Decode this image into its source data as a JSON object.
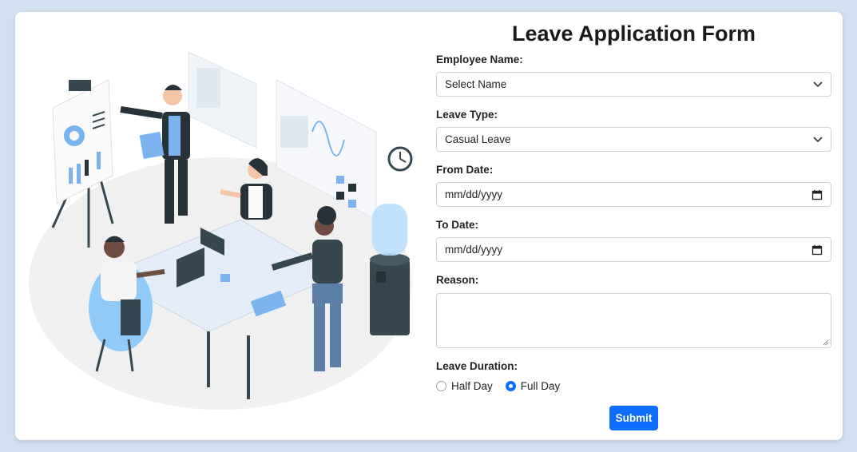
{
  "form": {
    "title": "Leave Application Form",
    "employee_name": {
      "label": "Employee Name:",
      "value": "Select Name"
    },
    "leave_type": {
      "label": "Leave Type:",
      "value": "Casual Leave"
    },
    "from_date": {
      "label": "From Date:",
      "value": "mm/dd/yyyy"
    },
    "to_date": {
      "label": "To Date:",
      "value": "mm/dd/yyyy"
    },
    "reason": {
      "label": "Reason:",
      "value": ""
    },
    "leave_duration": {
      "label": "Leave Duration:",
      "options": [
        {
          "label": "Half Day",
          "checked": false
        },
        {
          "label": "Full Day",
          "checked": true
        }
      ]
    },
    "submit_label": "Submit"
  },
  "colors": {
    "page_background": "#d3e0f0",
    "accent": "#0d6efd",
    "illustration_blue": "#7ab3ef",
    "illustration_dark": "#263238"
  },
  "illustration": {
    "icon": "office-meeting-illustration"
  }
}
